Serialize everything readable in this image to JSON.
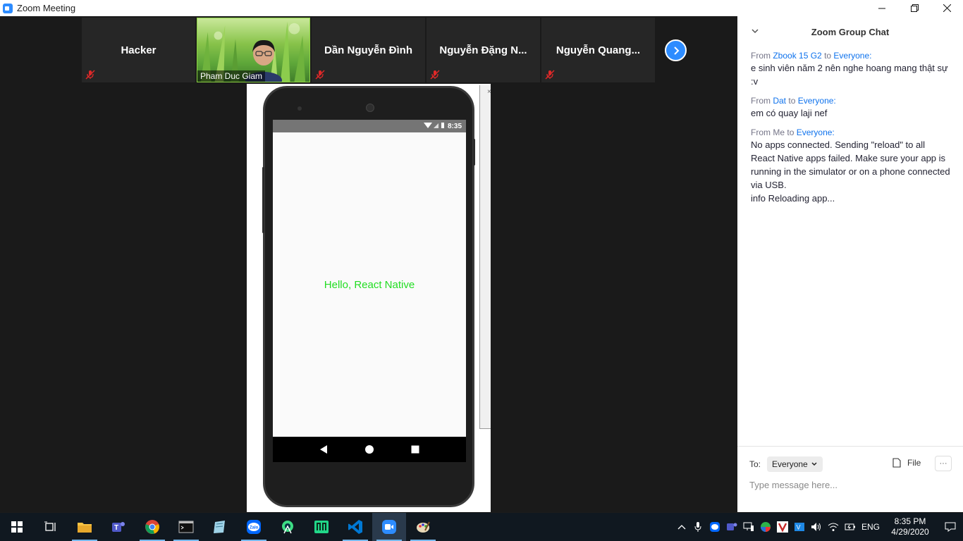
{
  "window": {
    "title": "Zoom Meeting"
  },
  "participants": [
    {
      "name": "Hacker",
      "muted": true
    },
    {
      "name": "Pham Duc Giam",
      "video": true
    },
    {
      "name": "Dần Nguyễn Đình",
      "muted": true
    },
    {
      "name": "Nguyễn Đặng N...",
      "muted": true
    },
    {
      "name": "Nguyễn  Quang...",
      "muted": true
    }
  ],
  "shared_screen": {
    "close_mark": "×",
    "phone": {
      "time": "8:35",
      "hello_text": "Hello, React Native"
    }
  },
  "chat": {
    "title": "Zoom Group Chat",
    "messages": [
      {
        "from_label": "From",
        "from": "Zbook 15 G2",
        "to_label": "to",
        "to": "Everyone:",
        "text": "e sinh viên năm 2 nên nghe hoang mang thật sự :v"
      },
      {
        "from_label": "From",
        "from": "Dat",
        "to_label": "to",
        "to": "Everyone:",
        "text": "em có quay laji nef"
      },
      {
        "from_label": "From",
        "from": "Me",
        "to_label": "to",
        "to": "Everyone:",
        "text": "No apps connected. Sending \"reload\" to all React Native apps failed. Make sure your app is running in the simulator or on a phone connected via USB.\ninfo Reloading app..."
      }
    ],
    "to_label": "To:",
    "to_value": "Everyone",
    "file_label": "File",
    "more_label": "···",
    "input_placeholder": "Type message here..."
  },
  "taskbar": {
    "apps": [
      "start-icon",
      "task-view-icon",
      "file-explorer-icon",
      "teams-icon",
      "chrome-icon",
      "terminal-icon",
      "notepad-icon",
      "zalo-icon",
      "android-studio-icon",
      "app-m-icon",
      "vscode-icon",
      "zoom-icon",
      "paint-icon"
    ],
    "tray": {
      "language": "ENG",
      "time": "8:35 PM",
      "date": "4/29/2020"
    }
  },
  "colors": {
    "zoom_blue": "#2d8cff",
    "hello_green": "#22dd22",
    "mute_red": "#e02828",
    "link_blue": "#0e72ed"
  }
}
